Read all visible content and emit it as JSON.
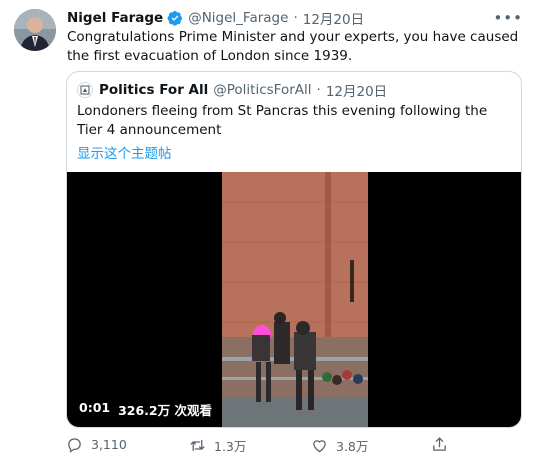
{
  "tweet": {
    "name": "Nigel Farage",
    "handle": "@Nigel_Farage",
    "separator": "·",
    "date": "12月20日",
    "text": "Congratulations Prime Minister and your experts, you have caused the first evacuation of London since 1939."
  },
  "quoted": {
    "name": "Politics For All",
    "handle": "@PoliticsForAll",
    "separator": "·",
    "date": "12月20日",
    "text": "Londoners fleeing from St Pancras this evening following the Tier 4 announcement",
    "show_thread": "显示这个主题帖",
    "video": {
      "duration": "0:01",
      "views": "326.2万 次观看"
    }
  },
  "actions": {
    "reply_count": "3,110",
    "retweet_count": "1.3万",
    "like_count": "3.8万"
  },
  "icons": {
    "verified": "verified-badge-icon",
    "more": "more-icon",
    "reply": "reply-icon",
    "retweet": "retweet-icon",
    "like": "like-icon",
    "share": "share-icon"
  },
  "colors": {
    "accent": "#1d9bf0",
    "text": "#0f1419",
    "muted": "#536471",
    "border": "#cfd9de"
  }
}
